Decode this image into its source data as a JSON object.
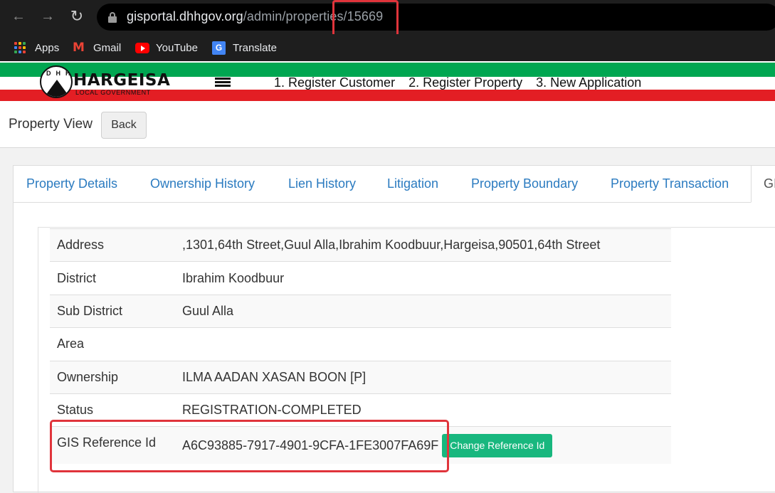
{
  "browser": {
    "url_host": "gisportal.dhhgov.org",
    "url_path": "/admin/properties/15669",
    "bookmarks": [
      {
        "label": "Apps",
        "icon": "apps-grid-icon"
      },
      {
        "label": "Gmail",
        "icon": "gmail-icon"
      },
      {
        "label": "YouTube",
        "icon": "youtube-icon"
      },
      {
        "label": "Translate",
        "icon": "google-translate-icon"
      }
    ],
    "colors": {
      "toolbar": "#1e1e1e",
      "omnibox": "#000000",
      "annotation": "#e0343b"
    }
  },
  "site": {
    "logo_letters": "DHH",
    "logo_name": "HARGEISA",
    "logo_subtitle": "LOCAL GOVERNMENT",
    "nav": [
      "1. Register Customer",
      "2. Register Property",
      "3. New Application"
    ],
    "colors": {
      "flag_green": "#00a651",
      "flag_red": "#e31e24"
    }
  },
  "page": {
    "title": "Property View",
    "back_label": "Back"
  },
  "tabs": {
    "items": [
      "Property Details",
      "Ownership History",
      "Lien History",
      "Litigation",
      "Property Boundary",
      "Property Transaction"
    ],
    "active_label": "GI"
  },
  "details": {
    "rows": [
      {
        "label": "Address",
        "value": ",1301,64th Street,Guul Alla,Ibrahim Koodbuur,Hargeisa,90501,64th Street"
      },
      {
        "label": "District",
        "value": "Ibrahim Koodbuur"
      },
      {
        "label": "Sub District",
        "value": "Guul Alla"
      },
      {
        "label": "Area",
        "value": ""
      },
      {
        "label": "Ownership",
        "value": "ILMA AADAN XASAN BOON [P]"
      },
      {
        "label": "Status",
        "value": "REGISTRATION-COMPLETED"
      },
      {
        "label": "GIS Reference Id",
        "value": "A6C93885-7917-4901-9CFA-1FE3007FA69F"
      }
    ],
    "change_reference_label": "Change Reference Id",
    "accent_button_color": "#18b77e",
    "link_color": "#2b7bc0"
  }
}
